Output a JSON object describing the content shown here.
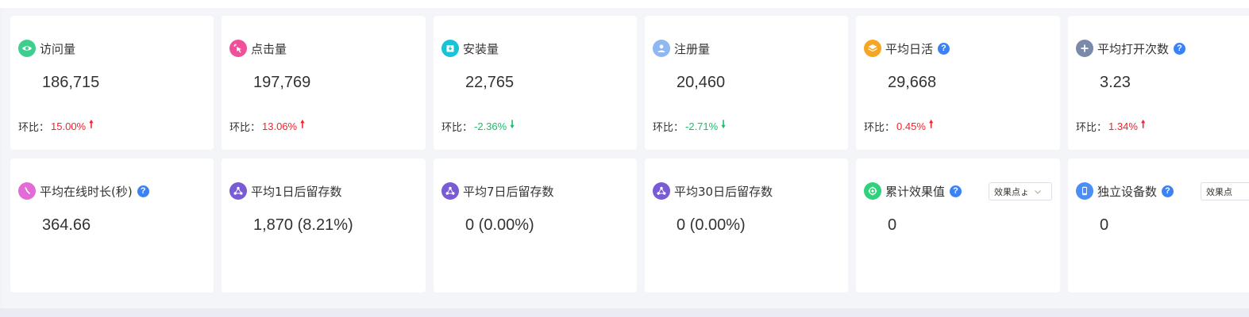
{
  "compare_label": "环比：",
  "row1": [
    {
      "title": "访问量",
      "value": "186,715",
      "change": "15.00%",
      "direction": "up",
      "icon": "eye-icon",
      "color": "#3ecf8e",
      "help": false
    },
    {
      "title": "点击量",
      "value": "197,769",
      "change": "13.06%",
      "direction": "up",
      "icon": "click-icon",
      "color": "#f0509a",
      "help": false
    },
    {
      "title": "安装量",
      "value": "22,765",
      "change": "-2.36%",
      "direction": "down",
      "icon": "install-icon",
      "color": "#17c3d6",
      "help": false
    },
    {
      "title": "注册量",
      "value": "20,460",
      "change": "-2.71%",
      "direction": "down",
      "icon": "user-icon",
      "color": "#8fb7f2",
      "help": false
    },
    {
      "title": "平均日活",
      "value": "29,668",
      "change": "0.45%",
      "direction": "up",
      "icon": "layers-icon",
      "color": "#f5a623",
      "help": true
    },
    {
      "title": "平均打开次数",
      "value": "3.23",
      "change": "1.34%",
      "direction": "up",
      "icon": "plus-icon",
      "color": "#7b8aa8",
      "help": true
    }
  ],
  "row2": [
    {
      "title": "平均在线时长(秒)",
      "value": "364.66",
      "icon": "clock-icon",
      "color": "#e36bd8",
      "help": true
    },
    {
      "title": "平均1日后留存数",
      "value": "1,870 (8.21%)",
      "icon": "network-icon",
      "color": "#7a5bd6",
      "help": false
    },
    {
      "title": "平均7日后留存数",
      "value": "0 (0.00%)",
      "icon": "network-icon",
      "color": "#7a5bd6",
      "help": false
    },
    {
      "title": "平均30日后留存数",
      "value": "0 (0.00%)",
      "icon": "network-icon",
      "color": "#7a5bd6",
      "help": false
    },
    {
      "title": "累计效果值",
      "value": "0",
      "icon": "target-icon",
      "color": "#2fd27a",
      "help": true,
      "select": "效果点",
      "select_trunc": "效果点ょ"
    },
    {
      "title": "独立设备数",
      "value": "0",
      "icon": "device-icon",
      "color": "#4a8ef6",
      "help": true,
      "select": "效果点"
    }
  ],
  "help_glyph": "?"
}
